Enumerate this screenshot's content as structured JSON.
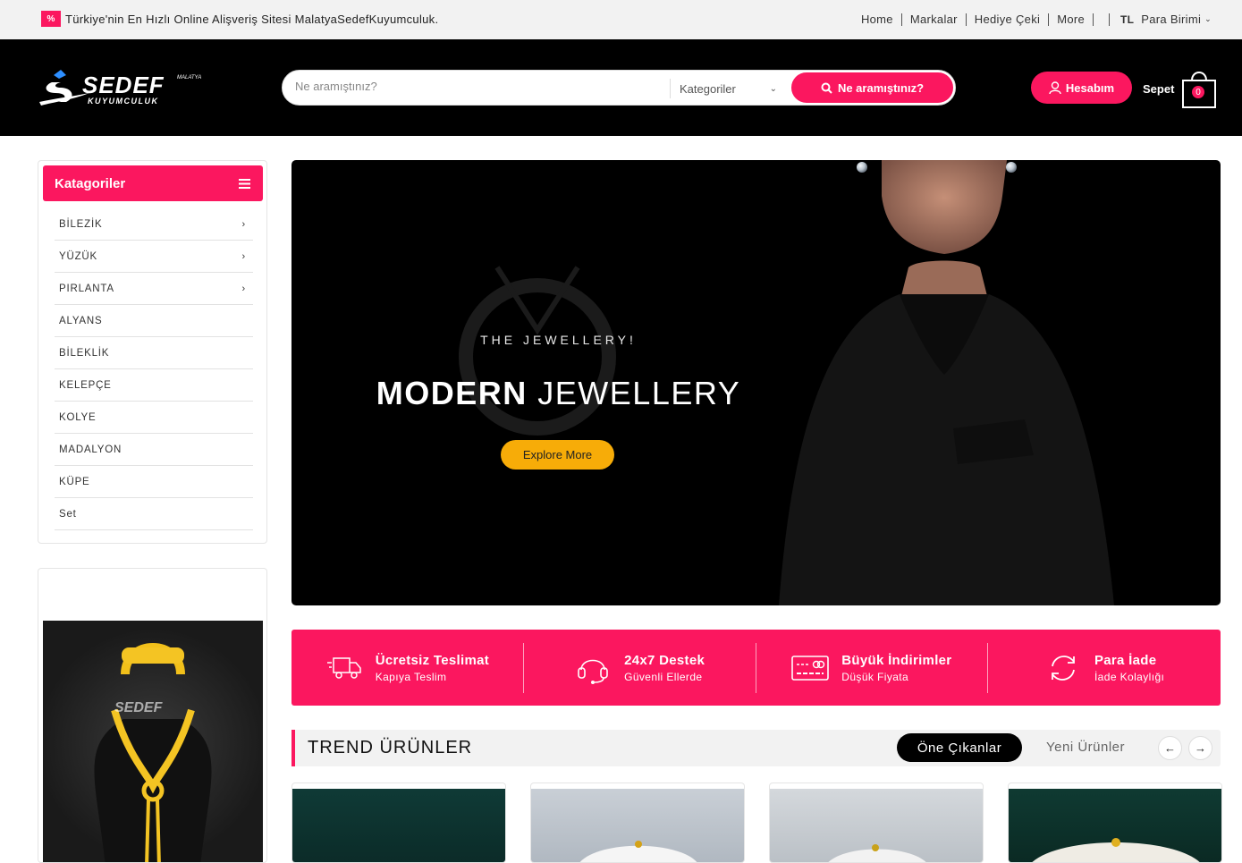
{
  "topbar": {
    "promo_badge": "%",
    "promo_text": "Türkiye'nin En Hızlı Online Alişveriş Sitesi MalatyaSedefKuyumculuk.",
    "links": [
      "Home",
      "Markalar",
      "Hediye Çeki",
      "More"
    ],
    "currency_code": "TL",
    "currency_label": "Para Birimi"
  },
  "header": {
    "logo_text": "SEDEF",
    "logo_sub": "KUYUMCULUK",
    "logo_small": "MALATYA",
    "search_placeholder": "Ne aramıştınız?",
    "category_label": "Kategoriler",
    "search_button": "Ne aramıştınız?",
    "account_label": "Hesabım",
    "cart_label": "Sepet",
    "cart_count": "0"
  },
  "sidebar": {
    "title": "Katagoriler",
    "items": [
      {
        "label": "BİLEZİK",
        "arrow": "›"
      },
      {
        "label": "YÜZÜK",
        "arrow": "›"
      },
      {
        "label": "PIRLANTA",
        "arrow": "›"
      },
      {
        "label": "ALYANS",
        "arrow": ""
      },
      {
        "label": "BİLEKLİK",
        "arrow": ""
      },
      {
        "label": "KELEPÇE",
        "arrow": ""
      },
      {
        "label": "KOLYE",
        "arrow": ""
      },
      {
        "label": "MADALYON",
        "arrow": ""
      },
      {
        "label": "KÜPE",
        "arrow": ""
      },
      {
        "label": "Set",
        "arrow": ""
      }
    ],
    "promo_watermark": "SEDEF"
  },
  "hero": {
    "tagline": "THE JEWELLERY!",
    "title_bold": "MODERN",
    "title_rest": "JEWELLERY",
    "button": "Explore More"
  },
  "features": [
    {
      "title": "Ücretsiz Teslimat",
      "subtitle": "Kapıya Teslim",
      "icon": "truck-icon"
    },
    {
      "title": "24x7 Destek",
      "subtitle": "Güvenli Ellerde",
      "icon": "headset-icon"
    },
    {
      "title": "Büyük İndirimler",
      "subtitle": "Düşük Fiyata",
      "icon": "card-icon"
    },
    {
      "title": "Para İade",
      "subtitle": "İade Kolaylığı",
      "icon": "refresh-icon"
    }
  ],
  "trend": {
    "title": "TREND ÜRÜNLER",
    "tab_active": "Öne Çıkanlar",
    "tab_inactive": "Yeni Ürünler",
    "prev": "←",
    "next": "→"
  },
  "colors": {
    "accent": "#fb175f",
    "header_bg": "#000000",
    "hero_button": "#f7ac08"
  }
}
